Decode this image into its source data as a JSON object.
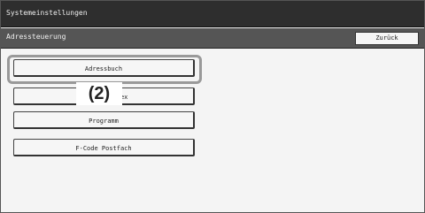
{
  "window": {
    "title": "Systemeinstellungen"
  },
  "subheader": {
    "title": "Adressteuerung",
    "back_label": "Zurück"
  },
  "menu": {
    "items": [
      {
        "label": "Adressbuch"
      },
      {
        "label": "Benutzerindex"
      },
      {
        "label": "Programm"
      },
      {
        "label": "F-Code Postfach"
      }
    ]
  },
  "annotation": {
    "label": "(2)"
  }
}
